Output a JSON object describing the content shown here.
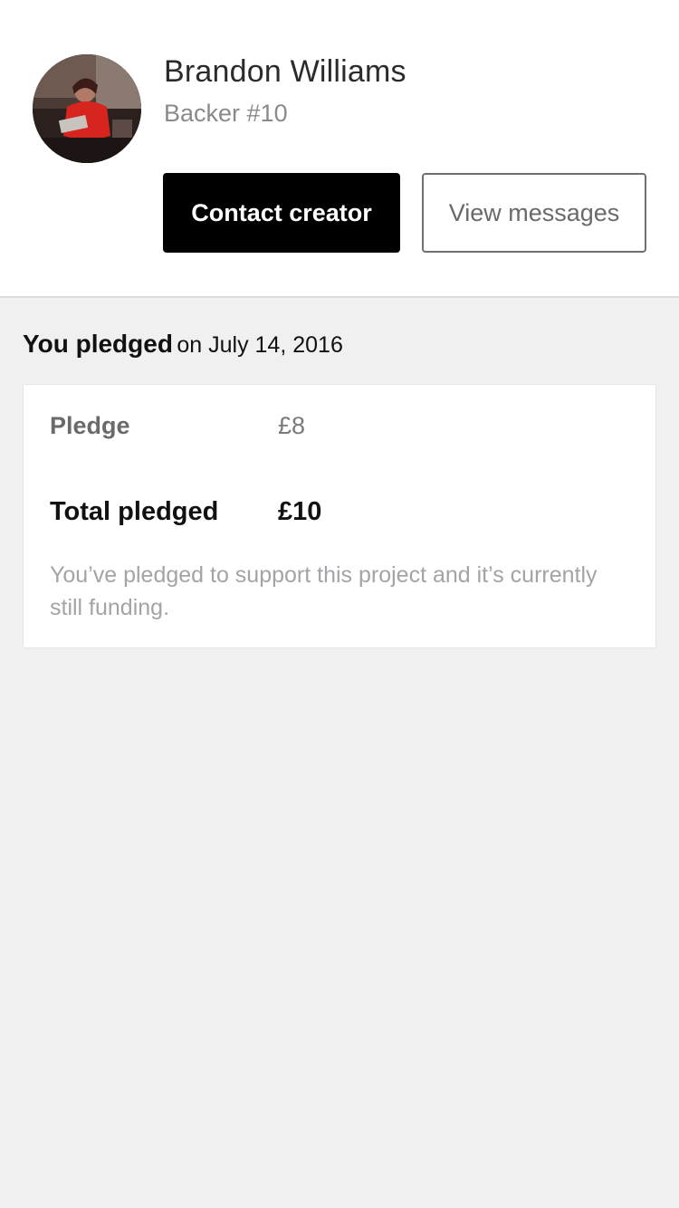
{
  "backer": {
    "name": "Brandon Williams",
    "label": "Backer #10"
  },
  "actions": {
    "contact_label": "Contact creator",
    "messages_label": "View messages"
  },
  "pledge_summary": {
    "heading": "You pledged",
    "date": "on July 14, 2016",
    "pledge_label": "Pledge",
    "pledge_amount": "£8",
    "total_label": "Total pledged",
    "total_amount": "£10",
    "status_note": "You’ve pledged to support this project and it’s currently still funding."
  },
  "colors": {
    "primary_button": "#000000",
    "page_background": "#f0f0f0",
    "muted_text": "#a3a3a8"
  }
}
